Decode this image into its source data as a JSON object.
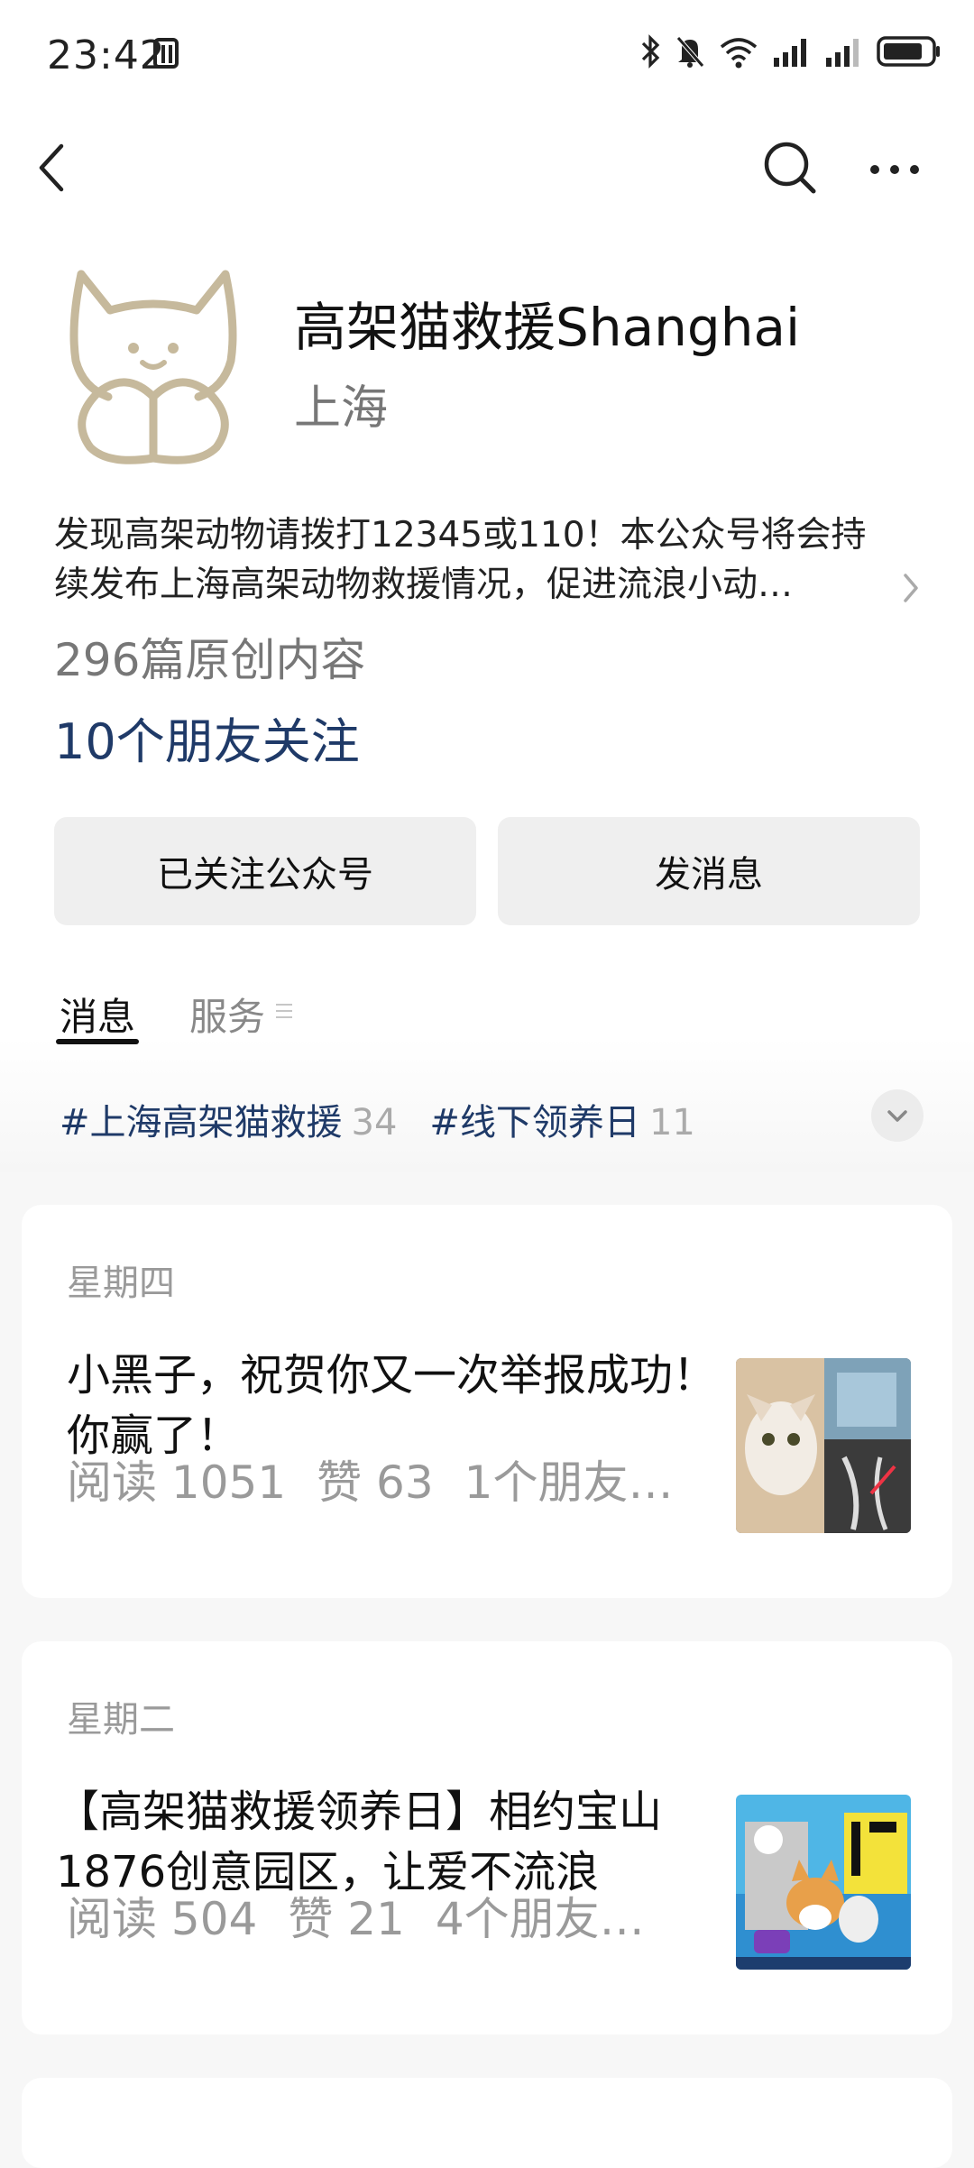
{
  "status_bar": {
    "time": "23:42"
  },
  "profile": {
    "name": "高架猫救援Shanghai",
    "region": "上海",
    "description_line1": "发现高架动物请拨打12345或110！本公众号将会持",
    "description_line2": "续发布上海高架动物救援情况，促进流浪小动…",
    "articles": "296篇原创内容",
    "friends": "10个朋友关注"
  },
  "buttons": {
    "follow": "已关注公众号",
    "message": "发消息"
  },
  "tabs": [
    {
      "label": "消息"
    },
    {
      "label": "服务"
    }
  ],
  "tags": [
    {
      "name": "#上海高架猫救援",
      "count": "34"
    },
    {
      "name": "#线下领养日",
      "count": "11"
    }
  ],
  "posts": [
    {
      "day": "星期四",
      "title": "小黑子，祝贺你又一次举报成功！你赢了！",
      "reads": "阅读 1051",
      "likes": "赞 63",
      "friends": "1个朋友…"
    },
    {
      "day": "星期二",
      "title": "【高架猫救援领养日】相约宝山1876创意园区，让爱不流浪",
      "reads": "阅读 504",
      "likes": "赞 21",
      "friends": "4个朋友…"
    }
  ]
}
